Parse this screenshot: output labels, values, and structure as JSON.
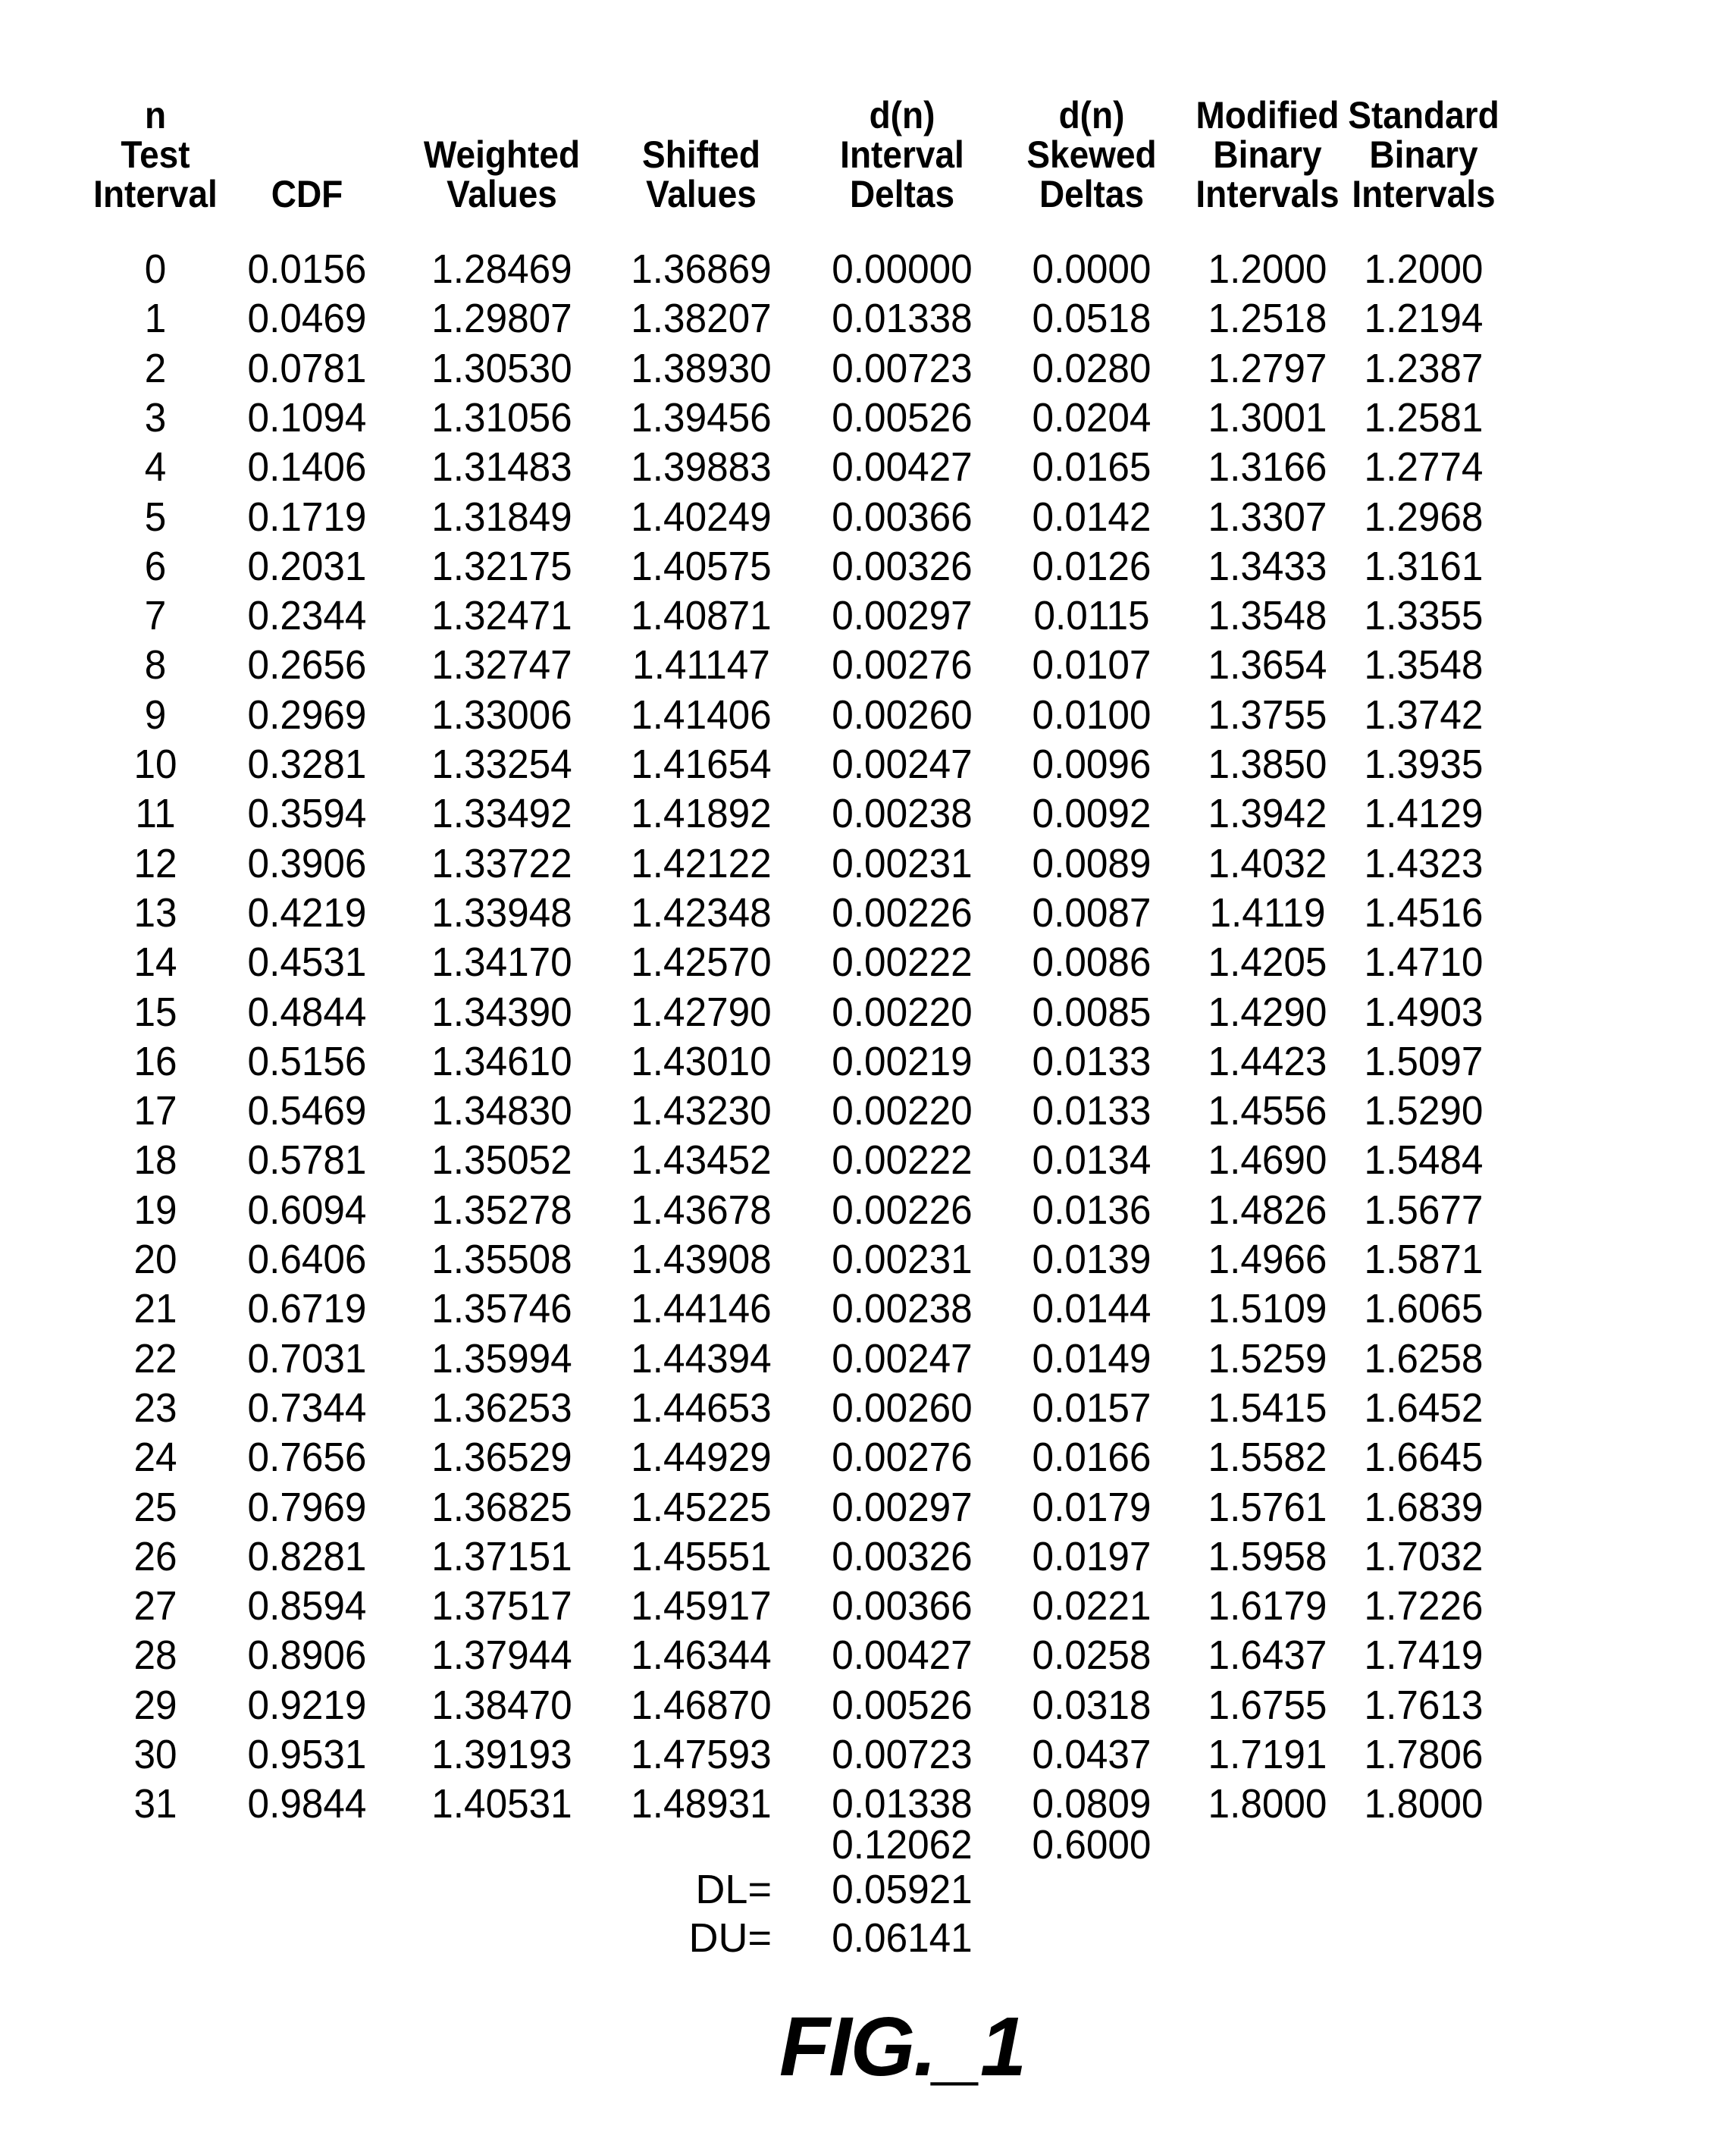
{
  "figure": {
    "label": "FIG._1"
  },
  "table": {
    "columns": [
      {
        "key": "n",
        "header": [
          "n",
          "Test",
          "Interval"
        ]
      },
      {
        "key": "cdf",
        "header": [
          "CDF"
        ]
      },
      {
        "key": "weighted",
        "header": [
          "Weighted",
          "Values"
        ]
      },
      {
        "key": "shifted",
        "header": [
          "Shifted",
          "Values"
        ]
      },
      {
        "key": "interval_deltas",
        "header": [
          "d(n)",
          "Interval",
          "Deltas"
        ]
      },
      {
        "key": "skewed_deltas",
        "header": [
          "d(n)",
          "Skewed",
          "Deltas"
        ]
      },
      {
        "key": "modified_binary",
        "header": [
          "Modified",
          "Binary",
          "Intervals"
        ]
      },
      {
        "key": "standard_binary",
        "header": [
          "Standard",
          "Binary",
          "Intervals"
        ]
      }
    ],
    "rows": [
      [
        "0",
        "0.0156",
        "1.28469",
        "1.36869",
        "0.00000",
        "0.0000",
        "1.2000",
        "1.2000"
      ],
      [
        "1",
        "0.0469",
        "1.29807",
        "1.38207",
        "0.01338",
        "0.0518",
        "1.2518",
        "1.2194"
      ],
      [
        "2",
        "0.0781",
        "1.30530",
        "1.38930",
        "0.00723",
        "0.0280",
        "1.2797",
        "1.2387"
      ],
      [
        "3",
        "0.1094",
        "1.31056",
        "1.39456",
        "0.00526",
        "0.0204",
        "1.3001",
        "1.2581"
      ],
      [
        "4",
        "0.1406",
        "1.31483",
        "1.39883",
        "0.00427",
        "0.0165",
        "1.3166",
        "1.2774"
      ],
      [
        "5",
        "0.1719",
        "1.31849",
        "1.40249",
        "0.00366",
        "0.0142",
        "1.3307",
        "1.2968"
      ],
      [
        "6",
        "0.2031",
        "1.32175",
        "1.40575",
        "0.00326",
        "0.0126",
        "1.3433",
        "1.3161"
      ],
      [
        "7",
        "0.2344",
        "1.32471",
        "1.40871",
        "0.00297",
        "0.0115",
        "1.3548",
        "1.3355"
      ],
      [
        "8",
        "0.2656",
        "1.32747",
        "1.41147",
        "0.00276",
        "0.0107",
        "1.3654",
        "1.3548"
      ],
      [
        "9",
        "0.2969",
        "1.33006",
        "1.41406",
        "0.00260",
        "0.0100",
        "1.3755",
        "1.3742"
      ],
      [
        "10",
        "0.3281",
        "1.33254",
        "1.41654",
        "0.00247",
        "0.0096",
        "1.3850",
        "1.3935"
      ],
      [
        "11",
        "0.3594",
        "1.33492",
        "1.41892",
        "0.00238",
        "0.0092",
        "1.3942",
        "1.4129"
      ],
      [
        "12",
        "0.3906",
        "1.33722",
        "1.42122",
        "0.00231",
        "0.0089",
        "1.4032",
        "1.4323"
      ],
      [
        "13",
        "0.4219",
        "1.33948",
        "1.42348",
        "0.00226",
        "0.0087",
        "1.4119",
        "1.4516"
      ],
      [
        "14",
        "0.4531",
        "1.34170",
        "1.42570",
        "0.00222",
        "0.0086",
        "1.4205",
        "1.4710"
      ],
      [
        "15",
        "0.4844",
        "1.34390",
        "1.42790",
        "0.00220",
        "0.0085",
        "1.4290",
        "1.4903"
      ],
      [
        "16",
        "0.5156",
        "1.34610",
        "1.43010",
        "0.00219",
        "0.0133",
        "1.4423",
        "1.5097"
      ],
      [
        "17",
        "0.5469",
        "1.34830",
        "1.43230",
        "0.00220",
        "0.0133",
        "1.4556",
        "1.5290"
      ],
      [
        "18",
        "0.5781",
        "1.35052",
        "1.43452",
        "0.00222",
        "0.0134",
        "1.4690",
        "1.5484"
      ],
      [
        "19",
        "0.6094",
        "1.35278",
        "1.43678",
        "0.00226",
        "0.0136",
        "1.4826",
        "1.5677"
      ],
      [
        "20",
        "0.6406",
        "1.35508",
        "1.43908",
        "0.00231",
        "0.0139",
        "1.4966",
        "1.5871"
      ],
      [
        "21",
        "0.6719",
        "1.35746",
        "1.44146",
        "0.00238",
        "0.0144",
        "1.5109",
        "1.6065"
      ],
      [
        "22",
        "0.7031",
        "1.35994",
        "1.44394",
        "0.00247",
        "0.0149",
        "1.5259",
        "1.6258"
      ],
      [
        "23",
        "0.7344",
        "1.36253",
        "1.44653",
        "0.00260",
        "0.0157",
        "1.5415",
        "1.6452"
      ],
      [
        "24",
        "0.7656",
        "1.36529",
        "1.44929",
        "0.00276",
        "0.0166",
        "1.5582",
        "1.6645"
      ],
      [
        "25",
        "0.7969",
        "1.36825",
        "1.45225",
        "0.00297",
        "0.0179",
        "1.5761",
        "1.6839"
      ],
      [
        "26",
        "0.8281",
        "1.37151",
        "1.45551",
        "0.00326",
        "0.0197",
        "1.5958",
        "1.7032"
      ],
      [
        "27",
        "0.8594",
        "1.37517",
        "1.45917",
        "0.00366",
        "0.0221",
        "1.6179",
        "1.7226"
      ],
      [
        "28",
        "0.8906",
        "1.37944",
        "1.46344",
        "0.00427",
        "0.0258",
        "1.6437",
        "1.7419"
      ],
      [
        "29",
        "0.9219",
        "1.38470",
        "1.46870",
        "0.00526",
        "0.0318",
        "1.6755",
        "1.7613"
      ],
      [
        "30",
        "0.9531",
        "1.39193",
        "1.47593",
        "0.00723",
        "0.0437",
        "1.7191",
        "1.7806"
      ],
      [
        "31",
        "0.9844",
        "1.40531",
        "1.48931",
        "0.01338",
        "0.0809",
        "1.8000",
        "1.8000"
      ]
    ],
    "totals": {
      "interval_deltas": "0.12062",
      "skewed_deltas": "0.6000"
    },
    "summary": [
      {
        "label": "DL=",
        "value": "0.05921"
      },
      {
        "label": "DU=",
        "value": "0.06141"
      }
    ]
  }
}
